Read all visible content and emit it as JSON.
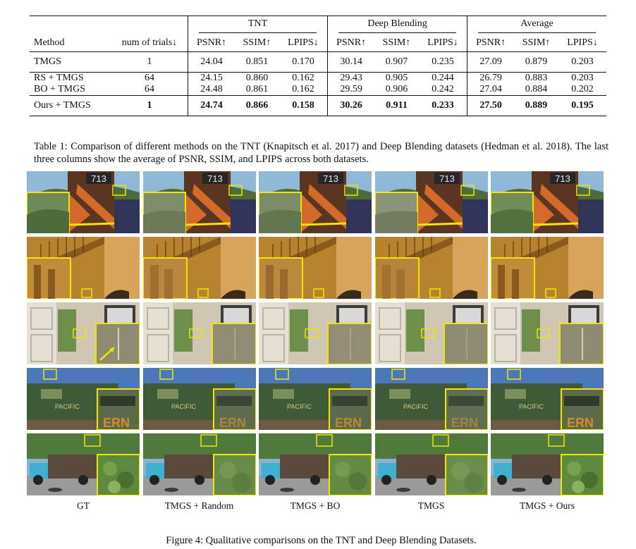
{
  "table": {
    "group_headers": [
      "TNT",
      "Deep Blending",
      "Average"
    ],
    "header_method": "Method",
    "header_trials": "num of trials↓",
    "metric_headers": [
      "PSNR↑",
      "SSIM↑",
      "LPIPS↓",
      "PSNR↑",
      "SSIM↑",
      "LPIPS↓",
      "PSNR↑",
      "SSIM↑",
      "LPIPS↓"
    ],
    "rows": [
      {
        "method": "TMGS",
        "trials": "1",
        "values": [
          "24.04",
          "0.851",
          "0.170",
          "30.14",
          "0.907",
          "0.235",
          "27.09",
          "0.879",
          "0.203"
        ]
      },
      {
        "method": "RS + TMGS",
        "trials": "64",
        "values": [
          "24.15",
          "0.860",
          "0.162",
          "29.43",
          "0.905",
          "0.244",
          "26.79",
          "0.883",
          "0.203"
        ]
      },
      {
        "method": "BO + TMGS",
        "trials": "64",
        "values": [
          "24.48",
          "0.861",
          "0.162",
          "29.59",
          "0.906",
          "0.242",
          "27.04",
          "0.884",
          "0.202"
        ]
      },
      {
        "method": "Ours + TMGS",
        "trials": "1",
        "values": [
          "24.74",
          "0.866",
          "0.158",
          "30.26",
          "0.911",
          "0.233",
          "27.50",
          "0.889",
          "0.195"
        ]
      }
    ]
  },
  "table_caption": "Table 1: Comparison of different methods on the TNT (Knapitsch et al. 2017) and Deep Blending datasets (Hedman et al. 2018). The last three columns show the average of PSNR, SSIM, and LPIPS across both datasets.",
  "figure": {
    "column_labels": [
      "GT",
      "TMGS + Random",
      "TMGS + BO",
      "TMGS",
      "TMGS + Ours"
    ],
    "number_plate": "713",
    "train_text": "PACIFIC",
    "inset_text": "ERN",
    "highlight_color": "#f2e600"
  },
  "figure_caption": "Figure 4: Qualitative comparisons on the TNT and Deep Blending Datasets."
}
